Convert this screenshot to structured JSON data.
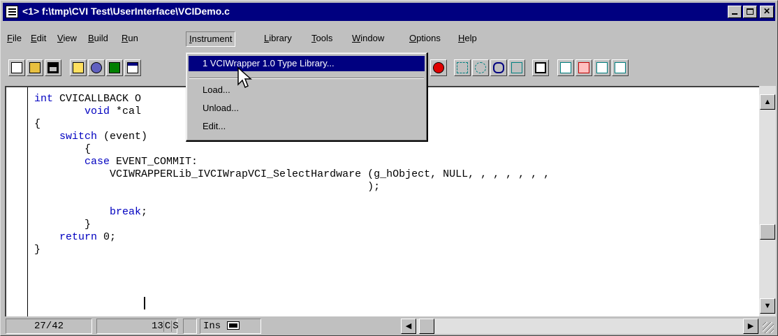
{
  "window": {
    "title": "<1> f:\\tmp\\CVI Test\\UserInterface\\VCIDemo.c",
    "buttons": [
      "minimize",
      "maximize",
      "close"
    ]
  },
  "menubar": {
    "items": [
      {
        "label": "File",
        "underline": "F"
      },
      {
        "label": "Edit",
        "underline": "E"
      },
      {
        "label": "View",
        "underline": "V"
      },
      {
        "label": "Build",
        "underline": "B"
      },
      {
        "label": "Run",
        "underline": "R"
      },
      {
        "label": "Instrument",
        "underline": "I"
      },
      {
        "label": "Library",
        "underline": "L"
      },
      {
        "label": "Tools",
        "underline": "T"
      },
      {
        "label": "Window",
        "underline": "W"
      },
      {
        "label": "Options",
        "underline": "O"
      },
      {
        "label": "Help",
        "underline": "H"
      }
    ],
    "active_index": 5
  },
  "instrument_menu": {
    "items": [
      {
        "label": "1 VCIWrapper 1.0 Type Library...",
        "selected": true
      },
      {
        "label": "Load...",
        "selected": false
      },
      {
        "label": "Unload...",
        "selected": false
      },
      {
        "label": "Edit...",
        "selected": false
      }
    ]
  },
  "editor": {
    "code_lines": [
      "int CVICALLBACK O                 control, int event,",
      "        void *cal                 int eventData2)",
      "{",
      "    switch (event)",
      "        {",
      "        case EVENT_COMMIT:",
      "            VCIWRAPPERLib_IVCIWrapVCI_SelectHardware (g_hObject, NULL, , , , , , ,",
      "                                                     );",
      "",
      "            break;",
      "        }",
      "    return 0;",
      "}"
    ]
  },
  "statusbar": {
    "position": "27/42",
    "column": "13",
    "c_flag": "C",
    "s_flag": "S",
    "mode": "Ins"
  },
  "colors": {
    "title_bar": "#000080",
    "face": "#c0c0c0",
    "keyword": "#0000c0",
    "highlight": "#000080"
  },
  "icons": [
    "new-file-icon",
    "open-folder-icon",
    "save-icon",
    "edit-icon",
    "tools-icon",
    "binoculars-icon",
    "panel-icon",
    "stop-icon",
    "step-into-icon",
    "step-over-icon",
    "glasses-icon",
    "find-icon",
    "clipboard-icon",
    "toggle-1-icon",
    "toggle-2-icon",
    "toggle-3-icon",
    "toggle-4-icon"
  ]
}
